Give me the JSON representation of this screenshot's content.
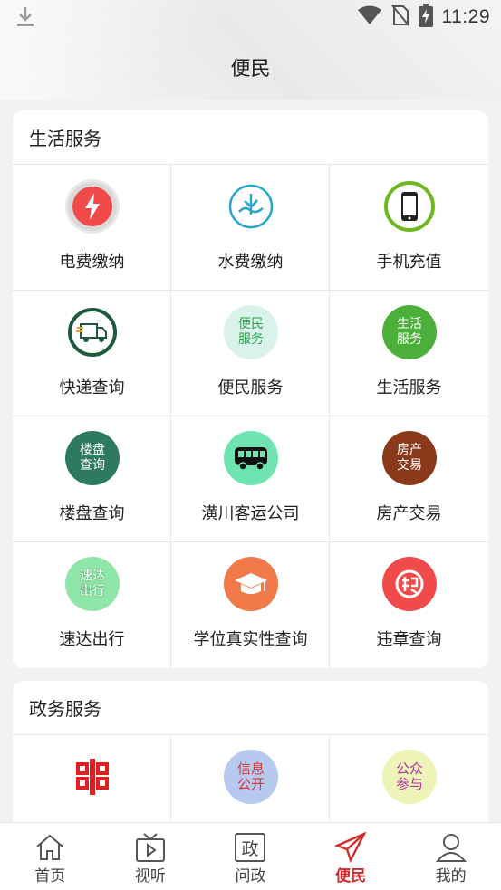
{
  "status_bar": {
    "time": "11:29",
    "icons": [
      "download-icon",
      "wifi-icon",
      "no-sim-icon",
      "battery-charging-icon"
    ]
  },
  "header": {
    "title": "便民"
  },
  "sections": [
    {
      "title": "生活服务",
      "items": [
        {
          "label": "电费缴纳",
          "icon": "lightning-icon",
          "color": "#f04a4a"
        },
        {
          "label": "水费缴纳",
          "icon": "water-icon",
          "color": "#2aa6c8"
        },
        {
          "label": "手机充值",
          "icon": "phone-icon",
          "color": "#6fb81f"
        },
        {
          "label": "快递查询",
          "icon": "delivery-truck-icon",
          "color": "#1d6b4a"
        },
        {
          "label": "便民服务",
          "icon_text": "便民\n服务",
          "color": "#d9f2ea",
          "text_color": "#2aa04a"
        },
        {
          "label": "生活服务",
          "icon_text": "生活\n服务",
          "color": "#4caf3a"
        },
        {
          "label": "楼盘查询",
          "icon_text": "楼盘\n查询",
          "color": "#2d7a5f"
        },
        {
          "label": "潢川客运公司",
          "icon": "bus-icon",
          "color": "#6fe3b0"
        },
        {
          "label": "房产交易",
          "icon_text": "房产\n交易",
          "color": "#8a3a1a"
        },
        {
          "label": "速达出行",
          "icon_text": "速达\n出行",
          "color": "#8ee6a8"
        },
        {
          "label": "学位真实性查询",
          "icon": "graduation-cap-icon",
          "color": "#f07a4a"
        },
        {
          "label": "违章查询",
          "icon": "violation-icon",
          "color": "#f04a4a"
        }
      ]
    },
    {
      "title": "政务服务",
      "items": [
        {
          "label": "",
          "icon": "gov-logo-icon",
          "color": "#e02020"
        },
        {
          "label": "",
          "icon_text": "信息\n公开",
          "color": "#b8c9ef",
          "text_color": "#d23a3a"
        },
        {
          "label": "",
          "icon_text": "公众\n参与",
          "color": "#eef3b8",
          "text_color": "#b030a0"
        }
      ]
    }
  ],
  "bottom_nav": [
    {
      "label": "首页",
      "icon": "home-icon",
      "active": false
    },
    {
      "label": "视听",
      "icon": "tv-play-icon",
      "active": false
    },
    {
      "label": "问政",
      "icon": "zheng-icon",
      "active": false
    },
    {
      "label": "便民",
      "icon": "paper-plane-icon",
      "active": true
    },
    {
      "label": "我的",
      "icon": "user-icon",
      "active": false
    }
  ]
}
